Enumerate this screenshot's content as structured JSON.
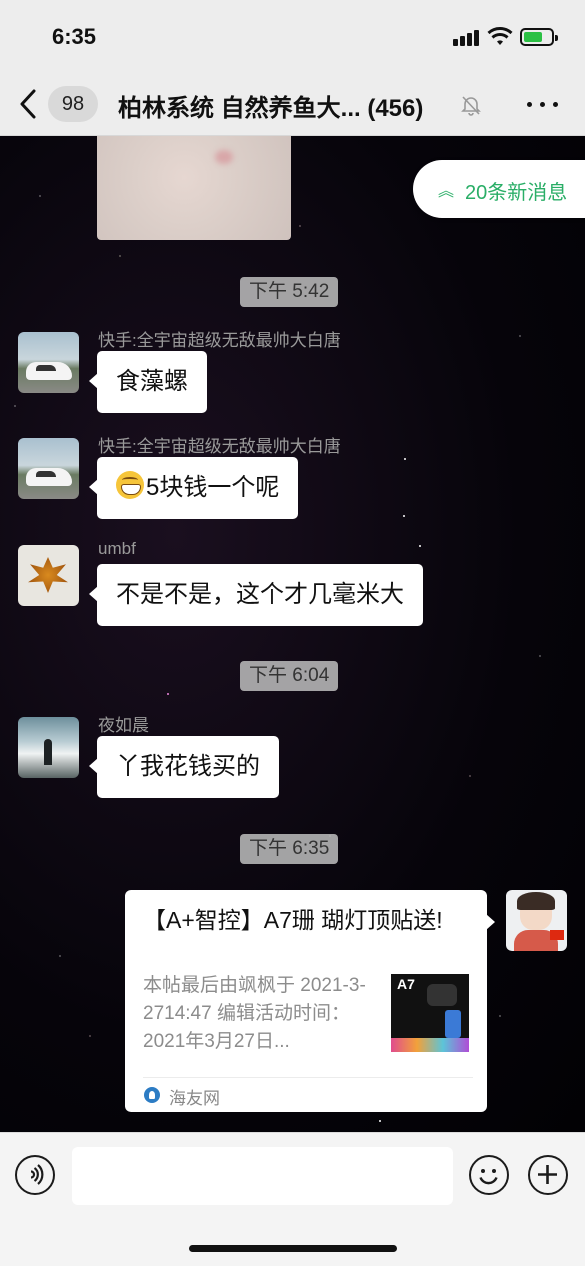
{
  "status_bar": {
    "time": "6:35"
  },
  "nav": {
    "unread_count": "98",
    "title": "柏林系统 自然养鱼大... (456)"
  },
  "new_messages_pill": "20条新消息",
  "messages": [
    {
      "type": "time",
      "text": "下午 5:42"
    },
    {
      "type": "text",
      "sender": "快手:全宇宙超级无敌最帅大白唐",
      "text": "食藻螺"
    },
    {
      "type": "text",
      "sender": "快手:全宇宙超级无敌最帅大白唐",
      "text": "5块钱一个呢"
    },
    {
      "type": "text",
      "sender": "umbf",
      "text": "不是不是，这个才几毫米大"
    },
    {
      "type": "time",
      "text": "下午 6:04"
    },
    {
      "type": "text",
      "sender": "夜如晨",
      "text": "丫我花钱买的"
    },
    {
      "type": "time",
      "text": "下午 6:35"
    },
    {
      "type": "link",
      "title": "【A+智控】A7珊 瑚灯顶贴送!",
      "desc": "本帖最后由飒枫于 2021-3-2714:47 编辑活动时间：2021年3月27日...",
      "thumb_label": "A7",
      "source": "海友网"
    }
  ],
  "input": {
    "placeholder": ""
  }
}
